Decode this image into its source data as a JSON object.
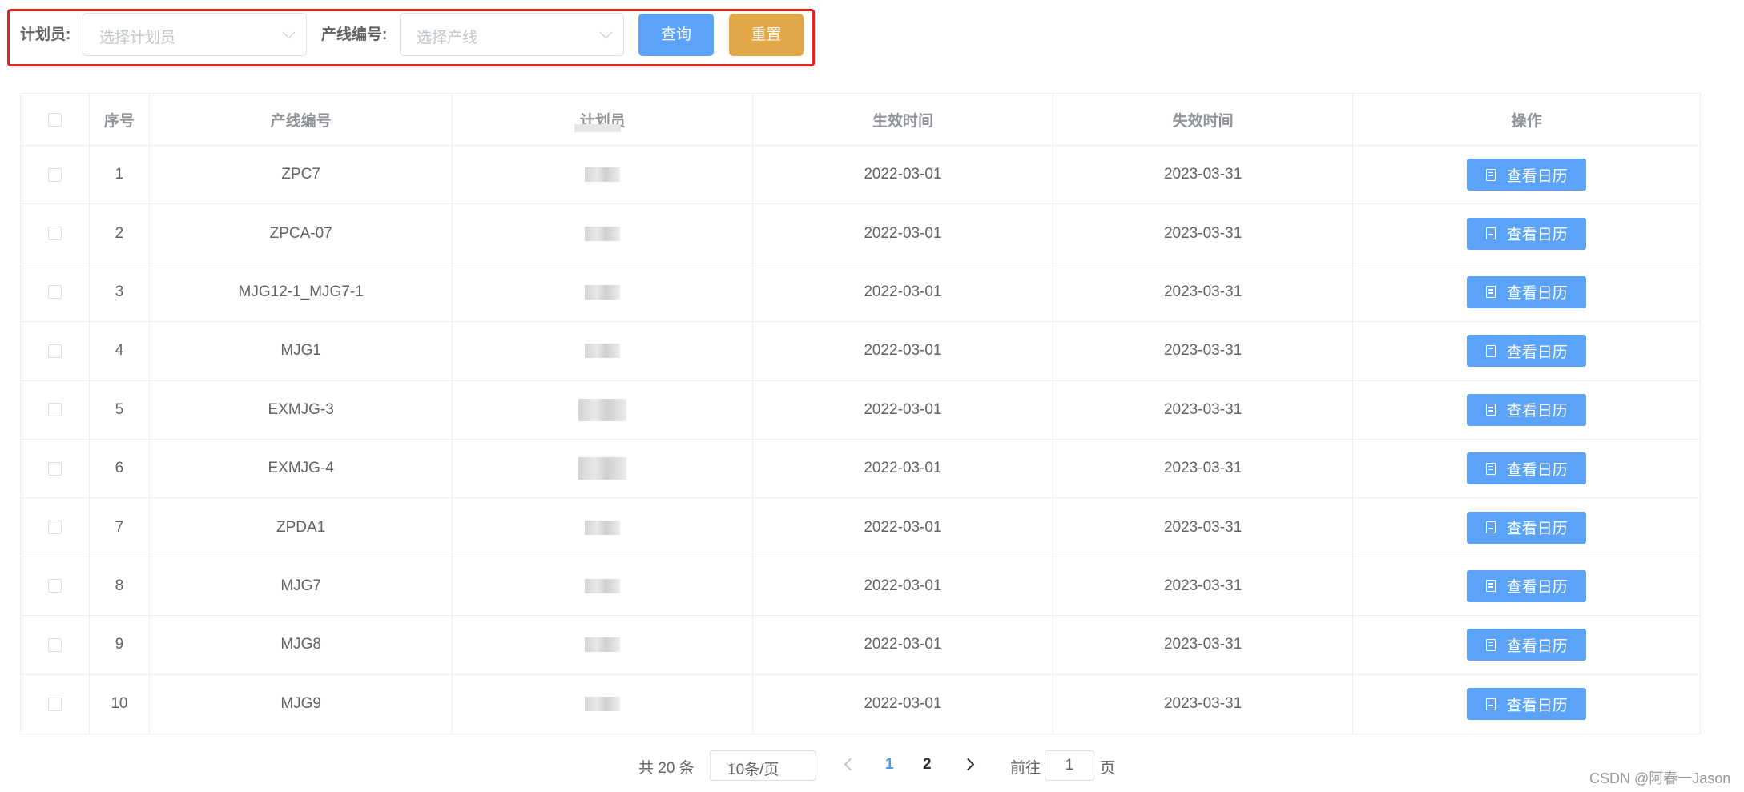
{
  "search": {
    "planner_label": "计划员:",
    "planner_placeholder": "选择计划员",
    "line_label": "产线编号:",
    "line_placeholder": "选择产线",
    "query_button": "查询",
    "reset_button": "重置",
    "highlight_color": "#e8231f"
  },
  "table": {
    "columns": [
      "序号",
      "产线编号",
      "计划员",
      "生效时间",
      "失效时间",
      "操作"
    ],
    "action_label": "查看日历",
    "rows": [
      {
        "index": "1",
        "line": "ZPC7",
        "start": "2022-03-01",
        "end": "2023-03-31"
      },
      {
        "index": "2",
        "line": "ZPCA-07",
        "start": "2022-03-01",
        "end": "2023-03-31"
      },
      {
        "index": "3",
        "line": "MJG12-1_MJG7-1",
        "start": "2022-03-01",
        "end": "2023-03-31"
      },
      {
        "index": "4",
        "line": "MJG1",
        "start": "2022-03-01",
        "end": "2023-03-31"
      },
      {
        "index": "5",
        "line": "EXMJG-3",
        "start": "2022-03-01",
        "end": "2023-03-31"
      },
      {
        "index": "6",
        "line": "EXMJG-4",
        "start": "2022-03-01",
        "end": "2023-03-31"
      },
      {
        "index": "7",
        "line": "ZPDA1",
        "start": "2022-03-01",
        "end": "2023-03-31"
      },
      {
        "index": "8",
        "line": "MJG7",
        "start": "2022-03-01",
        "end": "2023-03-31"
      },
      {
        "index": "9",
        "line": "MJG8",
        "start": "2022-03-01",
        "end": "2023-03-31"
      },
      {
        "index": "10",
        "line": "MJG9",
        "start": "2022-03-01",
        "end": "2023-03-31"
      }
    ]
  },
  "pagination": {
    "total": "共 20 条",
    "page_size": "10条/页",
    "pages": [
      "1",
      "2"
    ],
    "current_page": "1",
    "goto_prefix": "前往",
    "goto_value": "1",
    "goto_suffix": "页"
  },
  "watermark": "CSDN @阿春一Jason",
  "colors": {
    "primary": "#5ba3f9",
    "warning": "#e2a747",
    "active_page": "#409eff"
  }
}
